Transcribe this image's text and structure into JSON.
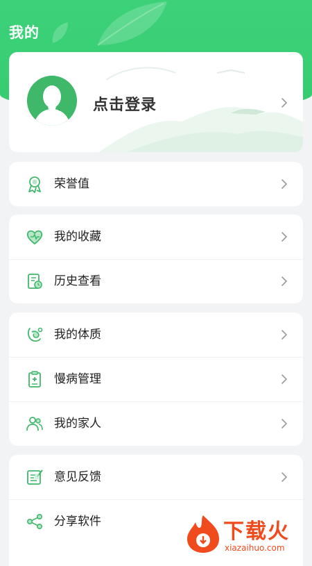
{
  "header": {
    "title": "我的"
  },
  "profile": {
    "login_label": "点击登录"
  },
  "groups": [
    {
      "items": [
        {
          "label": "荣誉值",
          "icon": "medal-icon"
        }
      ]
    },
    {
      "items": [
        {
          "label": "我的收藏",
          "icon": "heart-icon"
        },
        {
          "label": "历史查看",
          "icon": "history-icon"
        }
      ]
    },
    {
      "items": [
        {
          "label": "我的体质",
          "icon": "body-icon"
        },
        {
          "label": "慢病管理",
          "icon": "clipboard-icon"
        },
        {
          "label": "我的家人",
          "icon": "family-icon"
        }
      ]
    },
    {
      "items": [
        {
          "label": "意见反馈",
          "icon": "feedback-icon"
        },
        {
          "label": "分享软件",
          "icon": "share-icon"
        }
      ]
    }
  ],
  "watermark": {
    "brand": "下载火",
    "domain": "xiazaihuo.com"
  },
  "colors": {
    "accent": "#35cc70",
    "icon_green": "#3fb86a",
    "watermark": "#f04b1d"
  }
}
